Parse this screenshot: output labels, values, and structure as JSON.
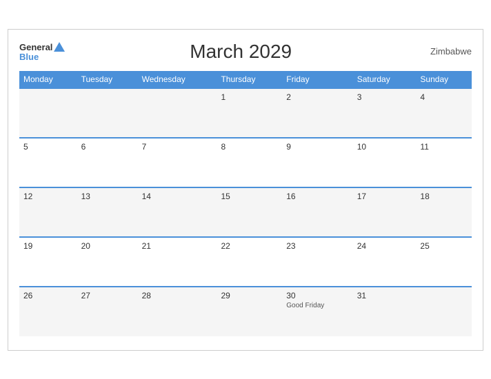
{
  "header": {
    "logo_general": "General",
    "logo_blue": "Blue",
    "title": "March 2029",
    "country": "Zimbabwe"
  },
  "weekdays": [
    "Monday",
    "Tuesday",
    "Wednesday",
    "Thursday",
    "Friday",
    "Saturday",
    "Sunday"
  ],
  "rows": [
    [
      {
        "day": "",
        "holiday": ""
      },
      {
        "day": "",
        "holiday": ""
      },
      {
        "day": "",
        "holiday": ""
      },
      {
        "day": "1",
        "holiday": ""
      },
      {
        "day": "2",
        "holiday": ""
      },
      {
        "day": "3",
        "holiday": ""
      },
      {
        "day": "4",
        "holiday": ""
      }
    ],
    [
      {
        "day": "5",
        "holiday": ""
      },
      {
        "day": "6",
        "holiday": ""
      },
      {
        "day": "7",
        "holiday": ""
      },
      {
        "day": "8",
        "holiday": ""
      },
      {
        "day": "9",
        "holiday": ""
      },
      {
        "day": "10",
        "holiday": ""
      },
      {
        "day": "11",
        "holiday": ""
      }
    ],
    [
      {
        "day": "12",
        "holiday": ""
      },
      {
        "day": "13",
        "holiday": ""
      },
      {
        "day": "14",
        "holiday": ""
      },
      {
        "day": "15",
        "holiday": ""
      },
      {
        "day": "16",
        "holiday": ""
      },
      {
        "day": "17",
        "holiday": ""
      },
      {
        "day": "18",
        "holiday": ""
      }
    ],
    [
      {
        "day": "19",
        "holiday": ""
      },
      {
        "day": "20",
        "holiday": ""
      },
      {
        "day": "21",
        "holiday": ""
      },
      {
        "day": "22",
        "holiday": ""
      },
      {
        "day": "23",
        "holiday": ""
      },
      {
        "day": "24",
        "holiday": ""
      },
      {
        "day": "25",
        "holiday": ""
      }
    ],
    [
      {
        "day": "26",
        "holiday": ""
      },
      {
        "day": "27",
        "holiday": ""
      },
      {
        "day": "28",
        "holiday": ""
      },
      {
        "day": "29",
        "holiday": ""
      },
      {
        "day": "30",
        "holiday": "Good Friday"
      },
      {
        "day": "31",
        "holiday": ""
      },
      {
        "day": "",
        "holiday": ""
      }
    ]
  ]
}
